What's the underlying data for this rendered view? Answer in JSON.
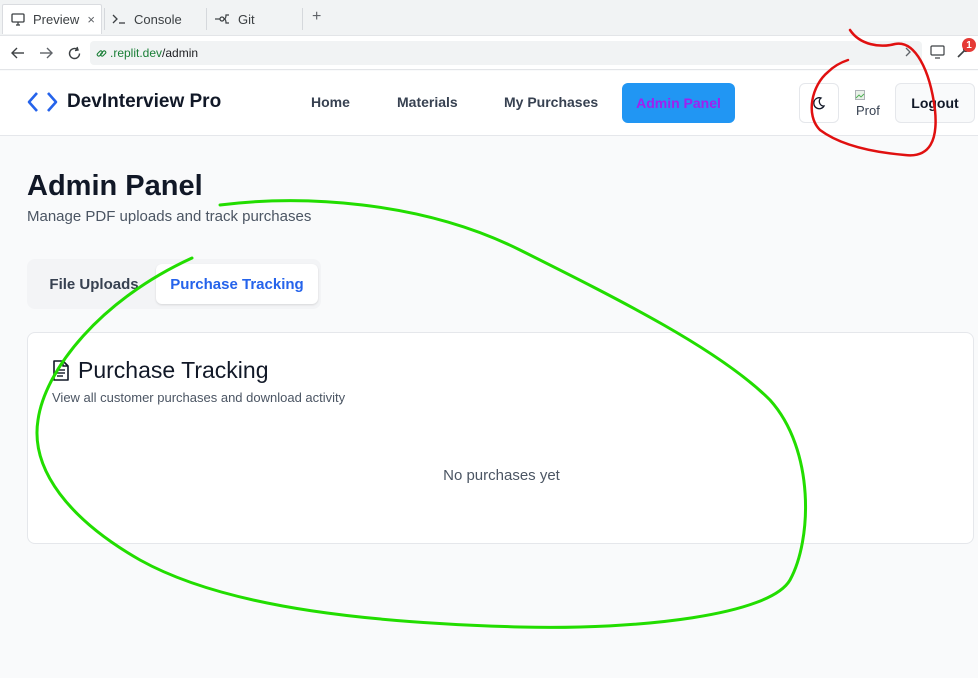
{
  "browser": {
    "tabs": [
      {
        "label": "Preview",
        "icon": "monitor-icon"
      },
      {
        "label": "Console",
        "icon": "terminal-icon"
      },
      {
        "label": "Git",
        "icon": "git-icon"
      }
    ],
    "close_glyph": "×",
    "new_tab_glyph": "+",
    "url_domain": ".replit.dev",
    "url_path": "/admin",
    "notification_count": "1"
  },
  "header": {
    "brand": "DevInterview Pro",
    "nav": [
      "Home",
      "Materials",
      "My Purchases"
    ],
    "admin_label": "Admin Panel",
    "avatar_alt": "Prof",
    "logout_label": "Logout"
  },
  "page": {
    "title": "Admin Panel",
    "subtitle": "Manage PDF uploads and track purchases",
    "tabs": [
      "File Uploads",
      "Purchase Tracking"
    ]
  },
  "card": {
    "title": "Purchase Tracking",
    "subtitle": "View all customer purchases and download activity",
    "empty_text": "No purchases yet"
  },
  "colors": {
    "accent": "#2196f3",
    "admin_label_text": "#a020f0",
    "active_tab_text": "#2563eb",
    "annotation_red": "#e01010",
    "annotation_green": "#22dd00"
  }
}
